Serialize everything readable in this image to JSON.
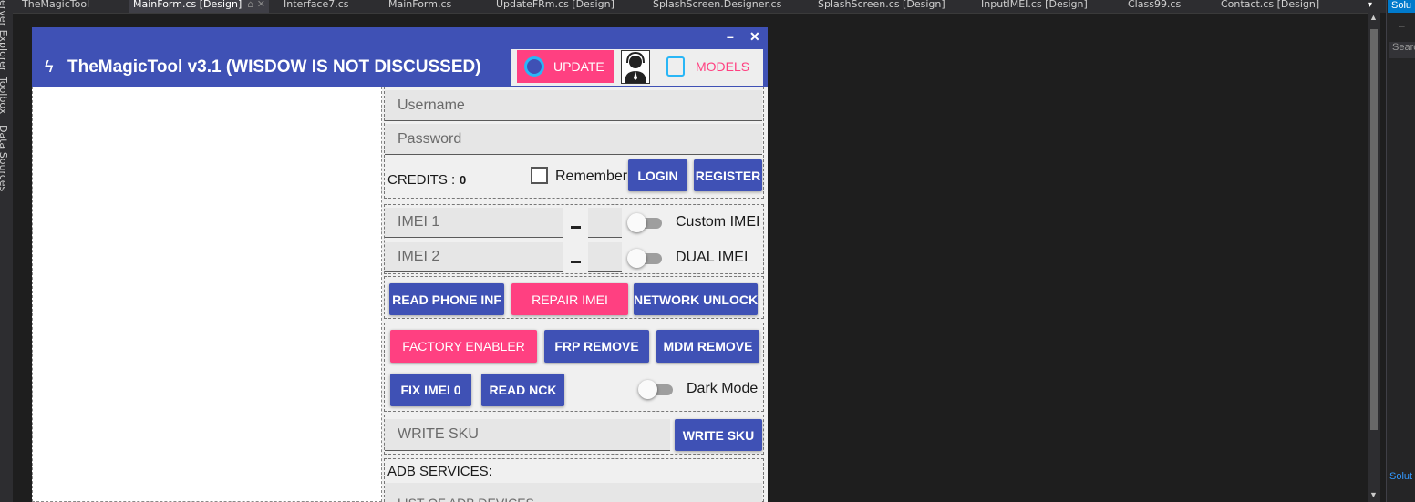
{
  "ide": {
    "tabs": [
      {
        "label": "TheMagicTool"
      },
      {
        "label": "MainForm.cs [Design]",
        "icons": "⌂ ✕"
      },
      {
        "label": "Interface7.cs"
      },
      {
        "label": "MainForm.cs"
      },
      {
        "label": "UpdateFRm.cs [Design]"
      },
      {
        "label": "SplashScreen.Designer.cs"
      },
      {
        "label": "SplashScreen.cs [Design]"
      },
      {
        "label": "InputIMEI.cs [Design]"
      },
      {
        "label": "Class99.cs"
      },
      {
        "label": "Contact.cs [Design]"
      }
    ],
    "dropdown_glyph": "▾",
    "rail": [
      {
        "label": "erver Explorer"
      },
      {
        "label": "Toolbox"
      },
      {
        "label": "Data Sources"
      }
    ],
    "solution_header": "Solu",
    "solution_search": "Searc",
    "solution_footer": "Solut",
    "back_glyph": "←",
    "scroll_up": "▲",
    "scroll_down": "▼"
  },
  "form": {
    "title": "TheMagicTool v3.1  (WISDOW IS NOT DISCUSSED)",
    "bolt_glyph": "ϟ",
    "minimize_glyph": "–",
    "close_glyph": "✕",
    "update_label": "UPDATE",
    "models_label": "MODELS",
    "username_placeholder": "Username",
    "password_placeholder": "Password",
    "credits_label": "CREDITS :",
    "credits_value": "0",
    "remember_label": "Remember",
    "login_label": "LOGIN",
    "register_label": "REGISTER",
    "imei1_placeholder": "IMEI 1",
    "imei2_placeholder": "IMEI 2",
    "custom_imei_label": "Custom IMEI",
    "dual_imei_label": "DUAL IMEI",
    "read_phone_label": "READ PHONE INF",
    "repair_imei_label": "REPAIR IMEI",
    "network_unlock_label": "NETWORK UNLOCK",
    "factory_enabler_label": "FACTORY ENABLER",
    "frp_remove_label": "FRP REMOVE",
    "mdm_remove_label": "MDM REMOVE",
    "fix_imei_label": "FIX IMEI 0",
    "read_nck_label": "READ NCK",
    "dark_mode_label": "Dark Mode",
    "write_sku_placeholder": "WRITE SKU",
    "write_sku_label": "WRITE SKU",
    "adb_services_label": "ADB SERVICES:",
    "adb_list_placeholder": "LIST OF ADB DEVICES"
  },
  "colors": {
    "primary": "#3f51b5",
    "accent": "#ff4081",
    "ide_background": "#1e1e1e"
  }
}
